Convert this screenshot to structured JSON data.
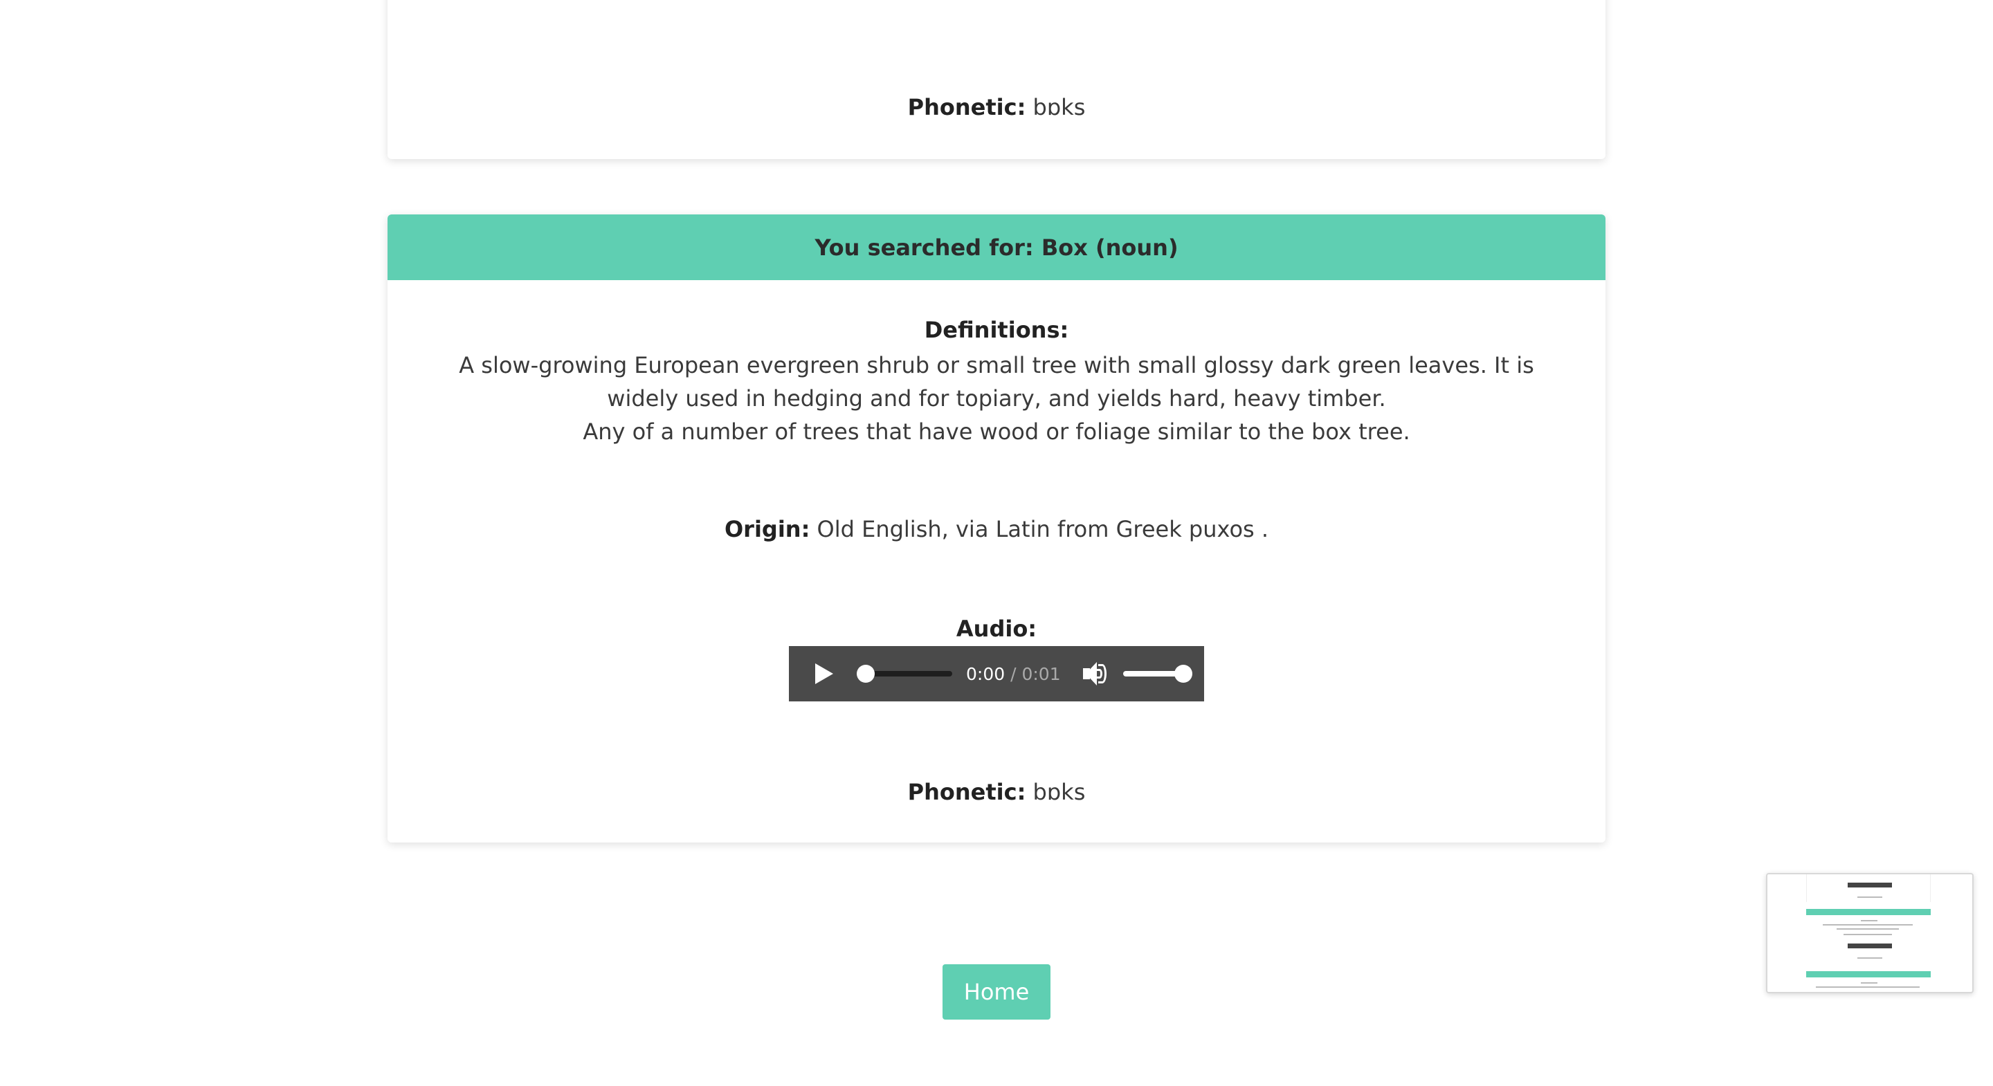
{
  "cards": [
    {
      "phonetic_label": "Phonetic:",
      "phonetic_value": "bɒks"
    },
    {
      "header": "You searched for: Box (noun)",
      "definitions_label": "Definitions:",
      "definitions": [
        "A slow-growing European evergreen shrub or small tree with small glossy dark green leaves. It is widely used in hedging and for topiary, and yields hard, heavy timber.",
        "Any of a number of trees that have wood or foliage similar to the box tree."
      ],
      "origin_label": "Origin:",
      "origin_value": "Old English, via Latin from Greek puxos .",
      "audio_label": "Audio:",
      "audio": {
        "current_time": "0:00",
        "duration": "/ 0:01",
        "play_icon": "play-icon",
        "volume_icon": "volume-icon",
        "progress_fraction": 0,
        "volume_fraction": 1
      },
      "phonetic_label": "Phonetic:",
      "phonetic_value": "bɒks"
    }
  ],
  "home_button": "Home",
  "colors": {
    "accent": "#5fcfb2",
    "player_bg": "#4a4a4a",
    "text": "#333333"
  }
}
